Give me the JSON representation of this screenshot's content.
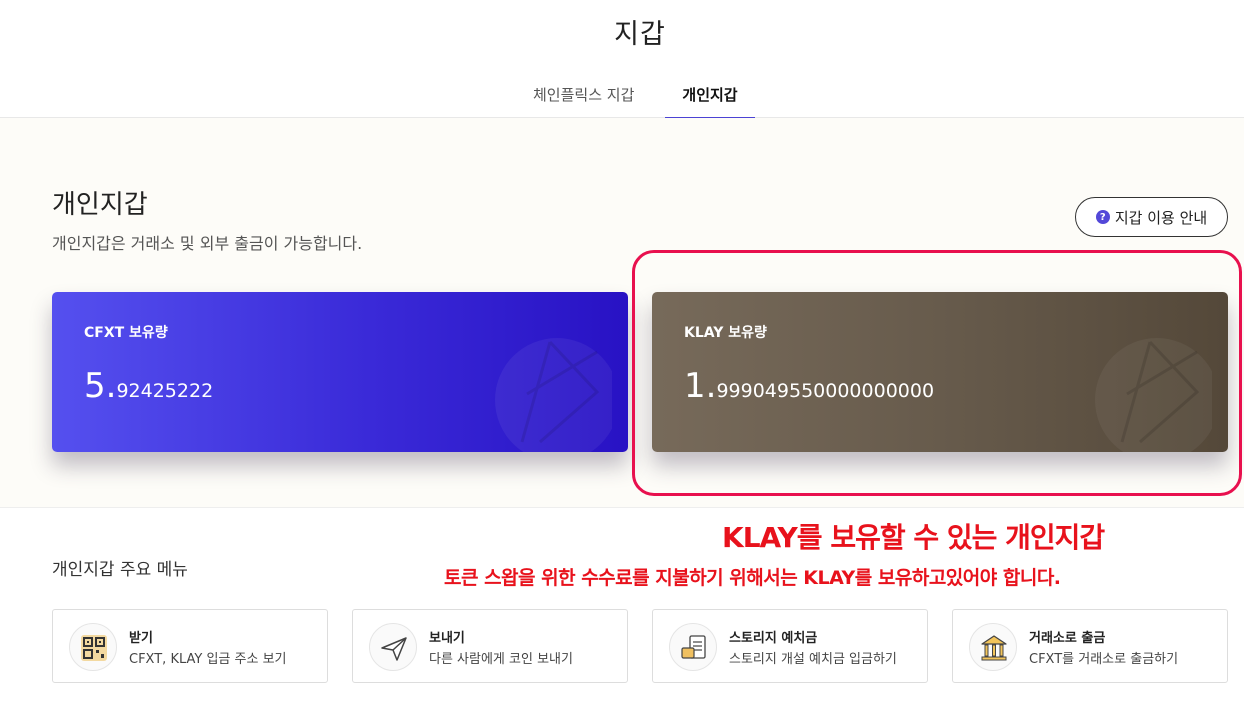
{
  "header": {
    "title": "지갑"
  },
  "tabs": [
    {
      "label": "체인플릭스 지갑",
      "active": false
    },
    {
      "label": "개인지갑",
      "active": true
    }
  ],
  "hero": {
    "title": "개인지갑",
    "description": "개인지갑은 거래소 및 외부 출금이 가능합니다.",
    "guide_button": "지갑 이용 안내",
    "guide_icon": "question-icon"
  },
  "cards": [
    {
      "label": "CFXT 보유량",
      "amount_int": "5.",
      "amount_dec": "92425222",
      "color": "#3a2ad8"
    },
    {
      "label": "KLAY 보유량",
      "amount_int": "1.",
      "amount_dec": "999049550000000000",
      "color": "#675b4c"
    }
  ],
  "annotation": {
    "headline": "KLAY를 보유할 수 있는 개인지갑",
    "subline": "토큰 스왑을 위한 수수료를 지불하기 위해서는 KLAY를 보유하고있어야 합니다.",
    "color": "#e8121c"
  },
  "menu": {
    "title": "개인지갑 주요 메뉴",
    "items": [
      {
        "name": "받기",
        "desc": "CFXT, KLAY 입금 주소 보기",
        "icon": "qr-code-icon"
      },
      {
        "name": "보내기",
        "desc": "다른 사람에게 코인 보내기",
        "icon": "paper-plane-icon"
      },
      {
        "name": "스토리지 예치금",
        "desc": "스토리지 개설 예치금 입금하기",
        "icon": "document-card-icon"
      },
      {
        "name": "거래소로 출금",
        "desc": "CFXT를 거래소로 출금하기",
        "icon": "bank-icon"
      }
    ]
  }
}
